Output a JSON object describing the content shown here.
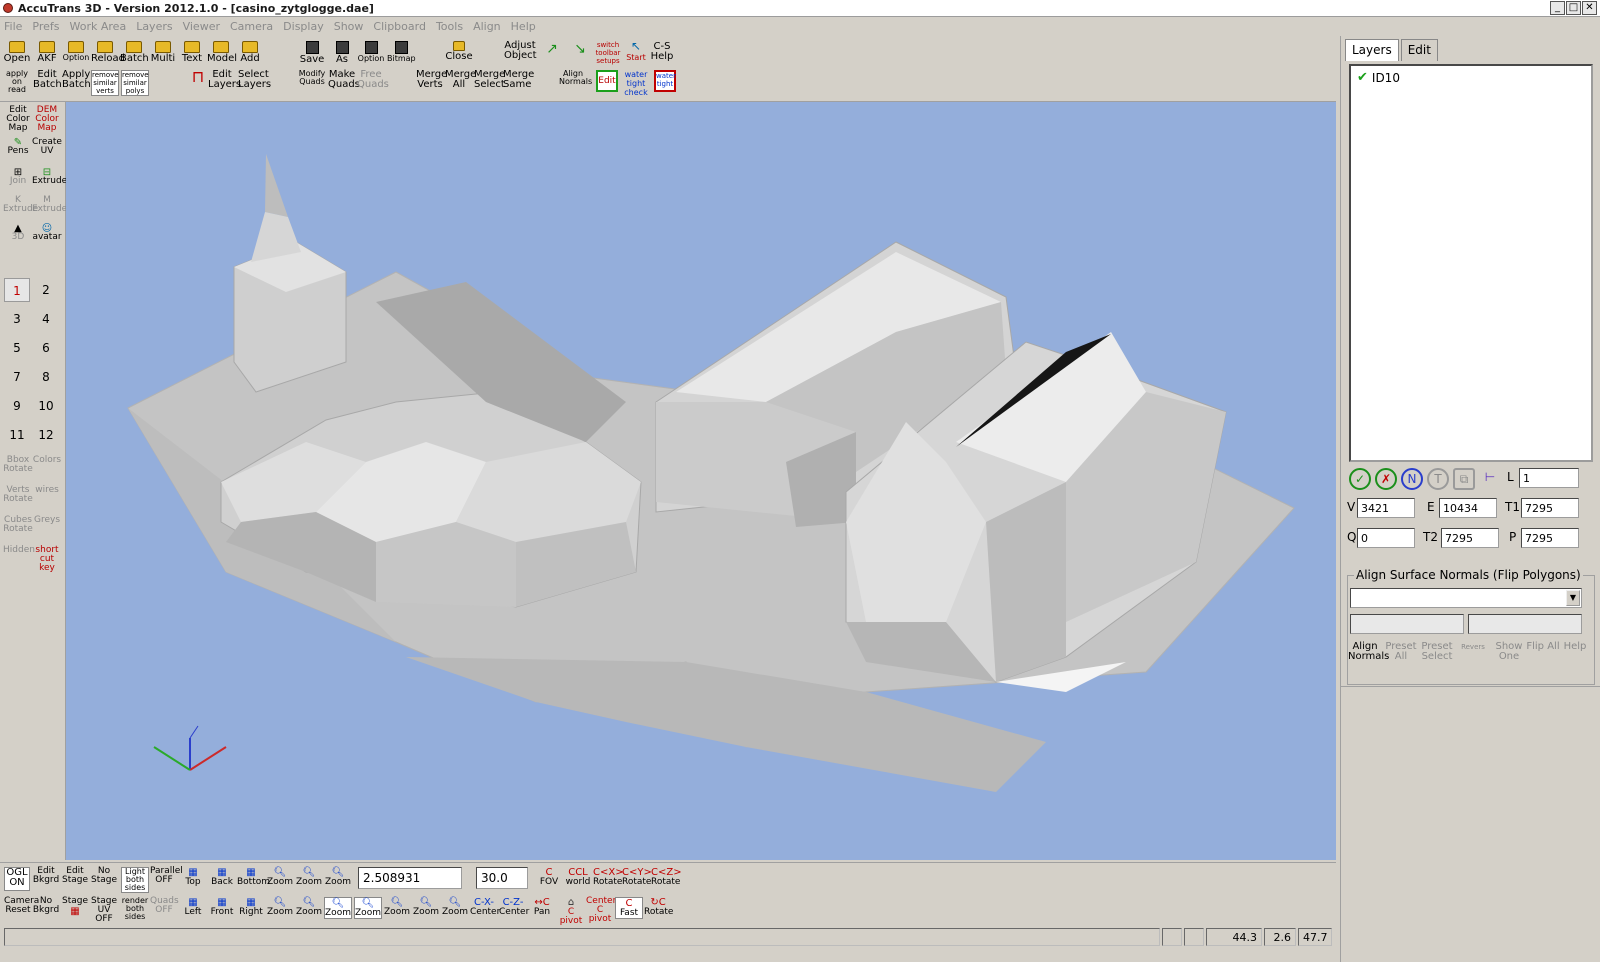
{
  "window": {
    "title": "AccuTrans 3D - Version 2012.1.0 - [casino_zytglogge.dae]"
  },
  "menus": [
    "File",
    "Prefs",
    "Work Area",
    "Layers",
    "Viewer",
    "Camera",
    "Display",
    "Show",
    "Clipboard",
    "Tools",
    "Align",
    "Help"
  ],
  "top_toolbar": {
    "row1": [
      {
        "label": "Open",
        "icon": "folder-open-icon"
      },
      {
        "label": "AKF",
        "icon": "folder-open-icon"
      },
      {
        "label": "Option",
        "icon": "folder-open-icon"
      },
      {
        "label": "Reload",
        "icon": "folder-open-icon"
      },
      {
        "label": "Batch",
        "icon": "folder-open-icon"
      },
      {
        "label": "Multi",
        "icon": "folder-open-icon"
      },
      {
        "label": "Text",
        "icon": "folder-open-icon"
      },
      {
        "label": "Model",
        "icon": "folder-open-icon"
      },
      {
        "label": "Add",
        "icon": "folder-open-icon"
      }
    ],
    "row2": [
      {
        "label": "apply on read"
      },
      {
        "label": "Edit Batch"
      },
      {
        "label": "Apply Batch"
      },
      {
        "label": "remove similar verts"
      },
      {
        "label": "remove similar polys"
      },
      {
        "label": "Edit Layers"
      },
      {
        "label": "Select Layers"
      }
    ],
    "save_group": [
      {
        "label": "Save",
        "icon": "disk-icon"
      },
      {
        "label": "As",
        "icon": "disk-icon"
      },
      {
        "label": "Option",
        "icon": "disk-icon"
      },
      {
        "label": "Bitmap",
        "icon": "disk-icon"
      }
    ],
    "quad_group": [
      {
        "label": "Modify Quads"
      },
      {
        "label": "Make Quads"
      },
      {
        "label": "Free Quads"
      }
    ],
    "close_label": "Close",
    "merge_group": [
      {
        "label": "Merge Verts"
      },
      {
        "label": "Merge All"
      },
      {
        "label": "Merge Select"
      },
      {
        "label": "Merge Same"
      }
    ],
    "adjust_object": "Adjust Object",
    "switch_toolbar": "switch toolbar setups",
    "cs_help": "C-S Help",
    "start": "Start",
    "align_normals": "Align Normals",
    "edit": "Edit",
    "water_tight_check": "water tight check",
    "water_tight": "water tight"
  },
  "left_toolbar": {
    "tools": [
      {
        "label": "Edit Color Map"
      },
      {
        "label": "DEM Color Map"
      },
      {
        "label": "Pens"
      },
      {
        "label": "Create UV"
      },
      {
        "label": "Join"
      },
      {
        "label": "Extrude"
      },
      {
        "label": "K Extrude"
      },
      {
        "label": "M Extrude"
      },
      {
        "label": "3D"
      },
      {
        "label": "avatar"
      }
    ],
    "numbers": [
      "1",
      "2",
      "3",
      "4",
      "5",
      "6",
      "7",
      "8",
      "9",
      "10",
      "11",
      "12"
    ],
    "bottom_tools": [
      {
        "label": "Bbox Rotate"
      },
      {
        "label": "Colors"
      },
      {
        "label": "Verts Rotate"
      },
      {
        "label": "wires"
      },
      {
        "label": "Cubes Rotate"
      },
      {
        "label": "Greys"
      },
      {
        "label": "Hidden"
      },
      {
        "label": "short cut key"
      }
    ]
  },
  "right_panel": {
    "tabs": [
      "Layers",
      "Edit"
    ],
    "layers": [
      {
        "name": "ID10",
        "checked": true
      }
    ],
    "layer_field": {
      "label": "L",
      "value": "1"
    },
    "stats": {
      "V": {
        "label": "V",
        "value": "3421"
      },
      "E": {
        "label": "E",
        "value": "10434"
      },
      "T1": {
        "label": "T1",
        "value": "7295"
      },
      "Q": {
        "label": "Q",
        "value": "0"
      },
      "T2": {
        "label": "T2",
        "value": "7295"
      },
      "P": {
        "label": "P",
        "value": "7295"
      }
    },
    "align_box": {
      "title": "Align Surface Normals (Flip Polygons)",
      "buttons": [
        {
          "label": "Align Normals"
        },
        {
          "label": "Preset All"
        },
        {
          "label": "Preset Select"
        },
        {
          "label": "Revers"
        },
        {
          "label": "Show One"
        },
        {
          "label": "Flip All"
        },
        {
          "label": "Help"
        }
      ]
    }
  },
  "bottom_toolbar": {
    "row1": [
      {
        "label": "OGL ON"
      },
      {
        "label": "Edit Bkgrd"
      },
      {
        "label": "Edit Stage"
      },
      {
        "label": "No Stage"
      },
      {
        "label": "Light both sides"
      },
      {
        "label": "Parallel OFF"
      },
      {
        "label": "Top"
      },
      {
        "label": "Back"
      },
      {
        "label": "Bottom"
      },
      {
        "label": "Zoom"
      },
      {
        "label": "Zoom"
      },
      {
        "label": "Zoom"
      }
    ],
    "row1_right": [
      {
        "label": "FOV",
        "icon": "C"
      },
      {
        "label": "world",
        "icon": "CCL"
      },
      {
        "label": "Rotate",
        "icon": "C<X>"
      },
      {
        "label": "Rotate",
        "icon": "C<Y>"
      },
      {
        "label": "Rotate",
        "icon": "C<Z>"
      }
    ],
    "zoom_value": "2.508931",
    "fov_value": "30.0",
    "row2": [
      {
        "label": "Camera Reset"
      },
      {
        "label": "No Bkgrd"
      },
      {
        "label": "Stage"
      },
      {
        "label": "Stage UV OFF"
      },
      {
        "label": "render both sides"
      },
      {
        "label": "Quads OFF"
      },
      {
        "label": "Left"
      },
      {
        "label": "Front"
      },
      {
        "label": "Right"
      },
      {
        "label": "Zoom"
      },
      {
        "label": "Zoom"
      },
      {
        "label": "Zoom"
      },
      {
        "label": "Zoom"
      },
      {
        "label": "Zoom"
      },
      {
        "label": "Zoom"
      },
      {
        "label": "Zoom"
      },
      {
        "label": "Center"
      },
      {
        "label": "Center"
      },
      {
        "label": "Pan"
      },
      {
        "label": "C pivot"
      },
      {
        "label": "Center C pivot"
      },
      {
        "label": "Fast"
      },
      {
        "label": "Rotate"
      }
    ]
  },
  "status_bar": {
    "values": [
      "44.3",
      "2.6",
      "47.7"
    ]
  },
  "colors": {
    "viewport_bg": "#94aedb",
    "model": "#c8c8c8",
    "panel": "#d4d0c8"
  }
}
